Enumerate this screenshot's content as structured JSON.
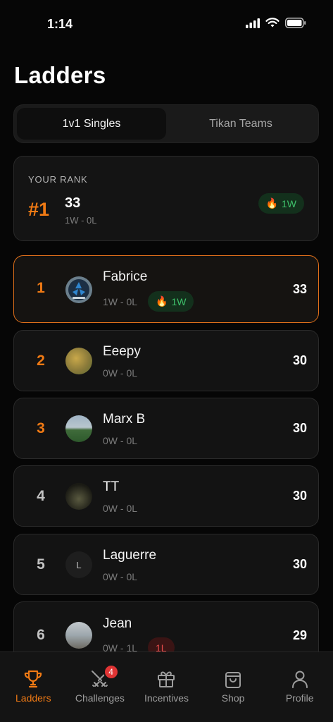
{
  "status_bar": {
    "time": "1:14"
  },
  "title": "Ladders",
  "tabs": [
    {
      "label": "1v1 Singles",
      "active": true
    },
    {
      "label": "Tikan Teams",
      "active": false
    }
  ],
  "your_rank": {
    "label": "YOUR RANK",
    "rank": "#1",
    "points": "33",
    "record": "1W - 0L",
    "streak": "1W",
    "streak_icon": "fire-icon"
  },
  "players": [
    {
      "rank": "1",
      "name": "Fabrice",
      "record": "1W - 0L",
      "streak": "1W",
      "streak_type": "win",
      "points": "33",
      "avatar": "logo-image"
    },
    {
      "rank": "2",
      "name": "Eeepy",
      "record": "0W - 0L",
      "points": "30",
      "avatar": "photo-image"
    },
    {
      "rank": "3",
      "name": "Marx B",
      "record": "0W - 0L",
      "points": "30",
      "avatar": "photo-image"
    },
    {
      "rank": "4",
      "name": "TT",
      "record": "0W - 0L",
      "points": "30",
      "avatar": "photo-image"
    },
    {
      "rank": "5",
      "name": "Laguerre",
      "record": "0W - 0L",
      "points": "30",
      "avatar_initial": "L"
    },
    {
      "rank": "6",
      "name": "Jean",
      "record": "0W - 1L",
      "streak": "1L",
      "streak_type": "loss",
      "points": "29",
      "avatar": "photo-image"
    }
  ],
  "nav": [
    {
      "label": "Ladders",
      "icon": "trophy-icon",
      "active": true
    },
    {
      "label": "Challenges",
      "icon": "swords-icon",
      "badge": "4"
    },
    {
      "label": "Incentives",
      "icon": "gift-icon"
    },
    {
      "label": "Shop",
      "icon": "shopping-bag-icon"
    },
    {
      "label": "Profile",
      "icon": "user-icon"
    }
  ],
  "colors": {
    "accent": "#f07a14",
    "win": "#3ec06a",
    "loss": "#e54a4a",
    "badge": "#e03434"
  }
}
